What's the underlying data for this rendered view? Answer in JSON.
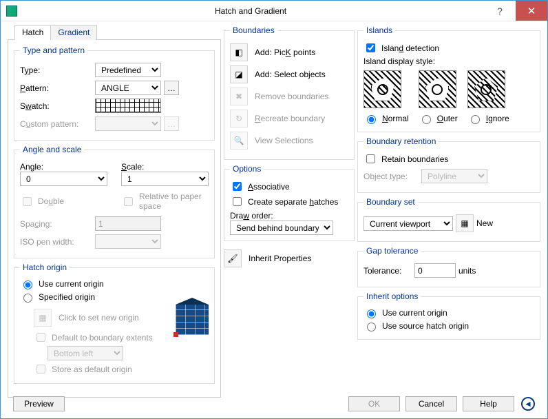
{
  "title": "Hatch and Gradient",
  "tabs": {
    "hatch": "Hatch",
    "gradient": "Gradient"
  },
  "type_pattern": {
    "legend": "Type and pattern",
    "type_label": "Type:",
    "type_u": "y",
    "type_value": "Predefined",
    "pattern_label": "Pattern:",
    "pattern_u": "P",
    "pattern_value": "ANGLE",
    "swatch_label": "Swatch:",
    "swatch_u": "w",
    "custom_label": "Custom pattern:",
    "custom_u": "u"
  },
  "angle_scale": {
    "legend": "Angle and scale",
    "angle_label": "Angle:",
    "angle_u": "g",
    "angle_value": "0",
    "scale_label": "Scale:",
    "scale_u": "S",
    "scale_value": "1",
    "double": "Double",
    "double_u": "u",
    "relative": "Relative to paper space",
    "spacing_label": "Spacing:",
    "spacing_u": "c",
    "spacing_value": "1",
    "iso_label": "ISO pen width:"
  },
  "hatch_origin": {
    "legend": "Hatch origin",
    "use_current": "Use current origin",
    "specified": "Specified origin",
    "click_new": "Click to set new origin",
    "default_ext": "Default to boundary extents",
    "anchor_value": "Bottom left",
    "store_default": "Store as default origin"
  },
  "boundaries": {
    "legend": "Boundaries",
    "pick": "Add: Pick points",
    "pick_u": "K",
    "select": "Add: Select objects",
    "remove": "Remove boundaries",
    "recreate": "Recreate boundary",
    "recreate_u": "R",
    "view": "View Selections"
  },
  "options": {
    "legend": "Options",
    "associative": "Associative",
    "assoc_u": "A",
    "separate": "Create separate hatches",
    "sep_u": "h",
    "draw_label": "Draw order:",
    "draw_u": "w",
    "draw_value": "Send behind boundary"
  },
  "inherit_props": "Inherit Properties",
  "islands": {
    "legend": "Islands",
    "detection": "Island detection",
    "det_u": "d",
    "style_label": "Island display style:",
    "normal": "Normal",
    "normal_u": "N",
    "outer": "Outer",
    "outer_u": "O",
    "ignore": "Ignore",
    "ignore_u": "I"
  },
  "boundary_retention": {
    "legend": "Boundary retention",
    "retain": "Retain boundaries",
    "obj_type_label": "Object type:",
    "obj_type_value": "Polyline"
  },
  "boundary_set": {
    "legend": "Boundary set",
    "value": "Current viewport",
    "new_btn": "New"
  },
  "gap": {
    "legend": "Gap tolerance",
    "label": "Tolerance:",
    "value": "0",
    "units": "units"
  },
  "inherit_options": {
    "legend": "Inherit options",
    "use_current": "Use current origin",
    "use_source": "Use source hatch origin"
  },
  "buttons": {
    "preview": "Preview",
    "ok": "OK",
    "cancel": "Cancel",
    "help": "Help"
  }
}
